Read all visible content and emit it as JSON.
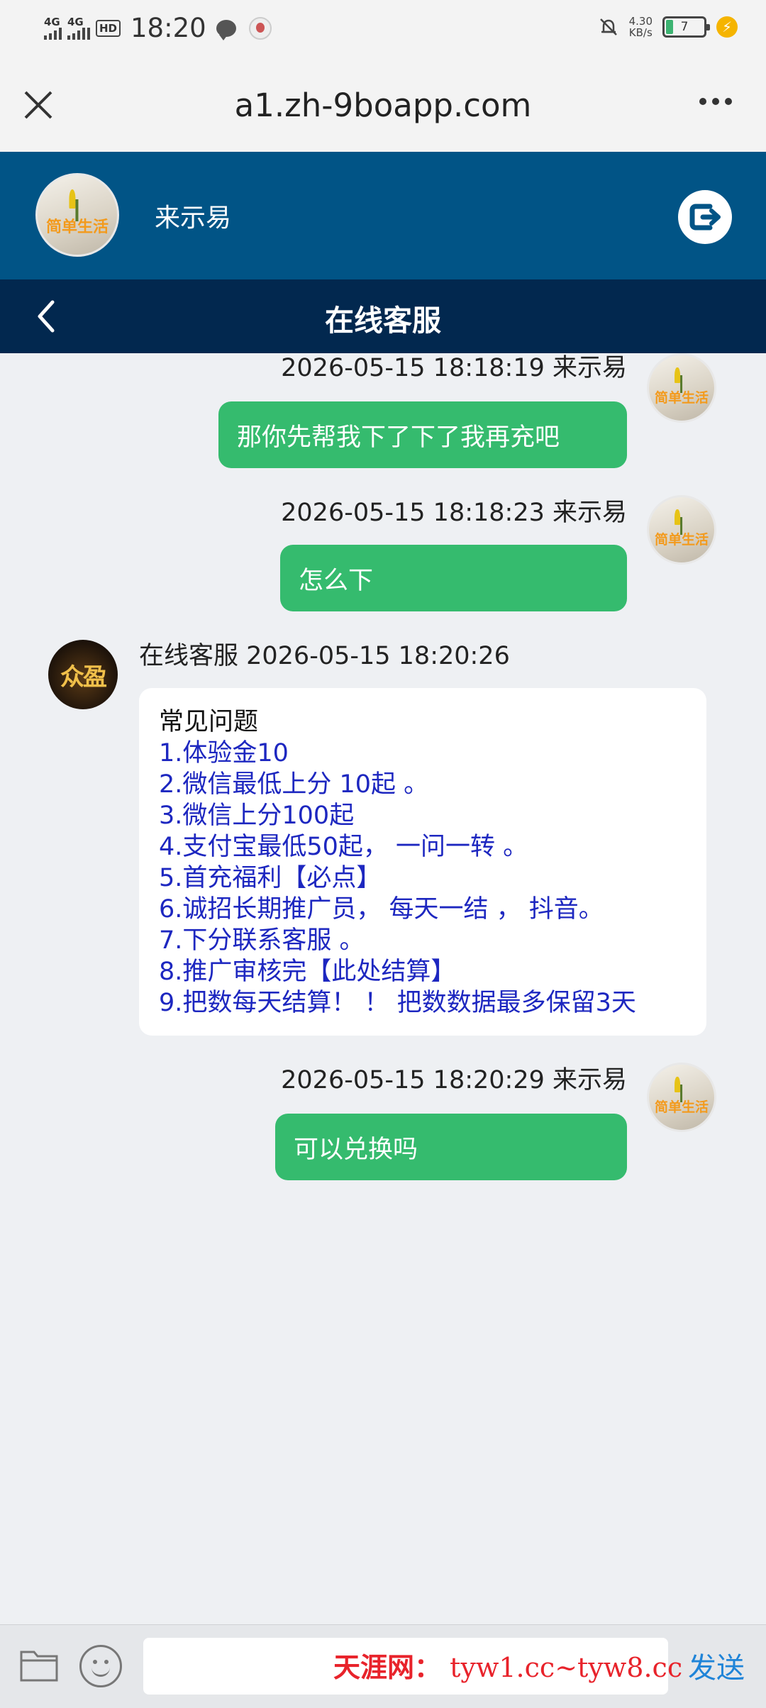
{
  "status_bar": {
    "network1": "4G",
    "network2": "4G",
    "hd": "HD",
    "time": "18:20",
    "net_speed_value": "4.30",
    "net_speed_unit": "KB/s",
    "battery": "7"
  },
  "browser": {
    "url": "a1.zh-9boapp.com"
  },
  "user_header": {
    "avatar_text": "简单生活",
    "name": "来示易"
  },
  "title_bar": {
    "title": "在线客服"
  },
  "messages": [
    {
      "meta": "2026-05-15 18:18:19 来示易",
      "text": "那你先帮我下了下了我再充吧"
    },
    {
      "meta": "2026-05-15 18:18:23 来示易",
      "text": "怎么下"
    },
    {
      "meta": "在线客服 2026-05-15 18:20:26",
      "avatar_text": "众盈",
      "heading": "常见问题",
      "faq": [
        "1.体验金10",
        "2.微信最低上分 10起 。",
        "3.微信上分100起",
        "4.支付宝最低50起， 一问一转 。",
        "5.首充福利【必点】",
        "6.诚招长期推广员， 每天一结 ， 抖音。",
        "7.下分联系客服 。",
        "8.推广审核完【此处结算】",
        "9.把数每天结算！ ！ 把数数据最多保留3天"
      ]
    },
    {
      "meta": "2026-05-15 18:20:29 来示易",
      "text": "可以兑换吗"
    }
  ],
  "input_bar": {
    "placeholder": "",
    "send_label": "发送"
  },
  "watermark": {
    "label": "天涯网：",
    "urls": "tyw1.cc~tyw8.cc"
  },
  "colors": {
    "header_blue": "#015486",
    "title_navy": "#02284f",
    "bubble_green": "#35bb6e",
    "faq_blue": "#1d27c0",
    "send_blue": "#1f84d8"
  }
}
